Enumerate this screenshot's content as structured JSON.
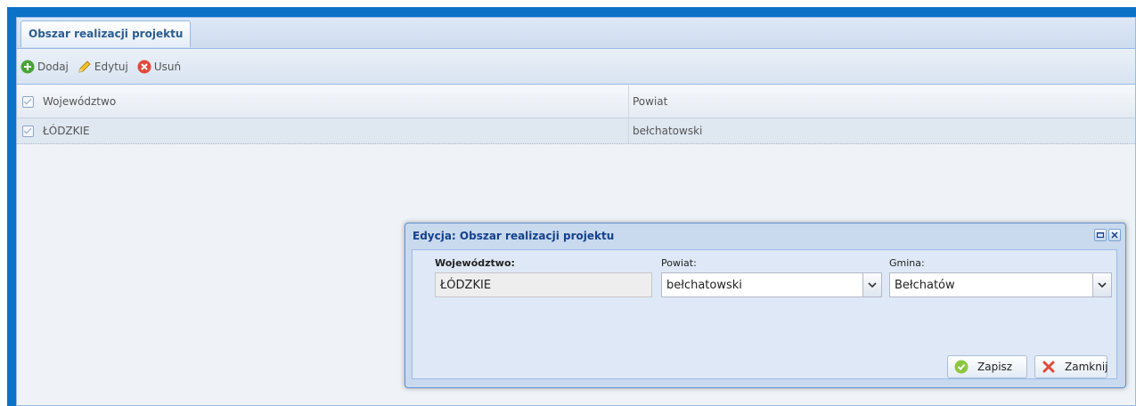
{
  "tab": {
    "label": "Obszar realizacji projektu"
  },
  "toolbar": {
    "add_label": "Dodaj",
    "edit_label": "Edytuj",
    "delete_label": "Usuń"
  },
  "grid": {
    "columns": [
      "Województwo",
      "Powiat"
    ],
    "rows": [
      {
        "wojewodztwo": "ŁÓDZKIE",
        "powiat": "bełchatowski",
        "checked": true
      }
    ]
  },
  "dialog": {
    "title": "Edycja: Obszar realizacji projektu",
    "fields": {
      "wojewodztwo_label": "Województwo:",
      "wojewodztwo_value": "ŁÓDZKIE",
      "powiat_label": "Powiat:",
      "powiat_value": "bełchatowski",
      "gmina_label": "Gmina:",
      "gmina_value": "Bełchatów"
    },
    "save_label": "Zapisz",
    "close_label": "Zamknij"
  },
  "colors": {
    "frame_border": "#0b72c8",
    "panel_bg": "#eff3f8",
    "dialog_title": "#15428b",
    "tab_text": "#2a5d92"
  }
}
